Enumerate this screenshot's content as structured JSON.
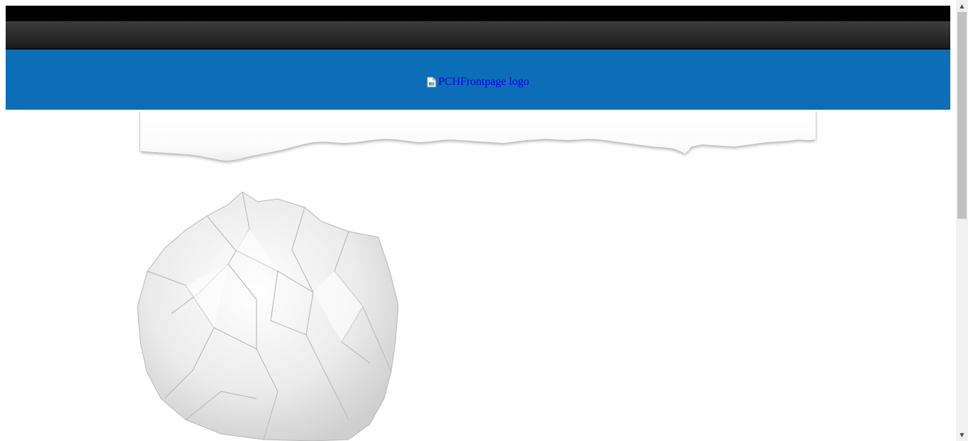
{
  "header": {
    "logo_alt": "PCHFrontpage logo",
    "background_color": "#0d6eb8"
  },
  "navbar": {
    "top_strip_color": "#000000",
    "bar_color": "#2a2a2a"
  },
  "link_color": "#0000ee",
  "scrollbar": {
    "up_icon": "scroll-up-arrow",
    "down_icon": "scroll-down-arrow"
  }
}
